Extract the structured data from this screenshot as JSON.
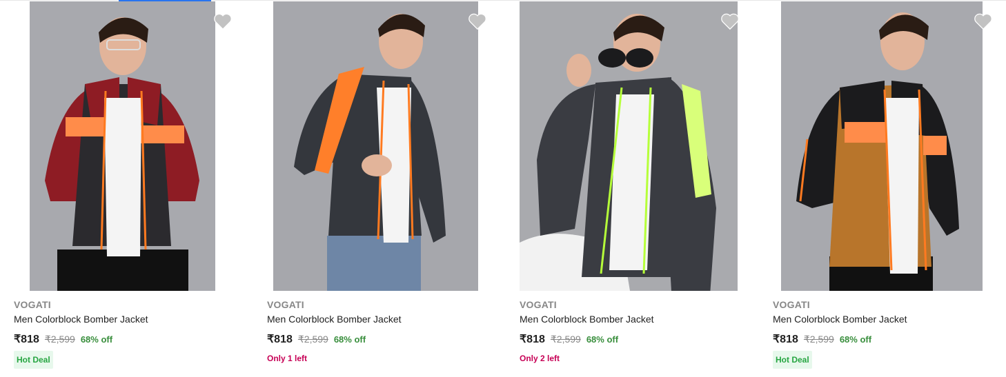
{
  "products": [
    {
      "brand": "VOGATI",
      "title": "Men Colorblock Bomber Jacket",
      "price": "₹818",
      "mrp": "₹2,599",
      "discount": "68% off",
      "badge": "Hot Deal",
      "stock": "",
      "image_icon": "product-photo",
      "colors": {
        "sleeve": "#8e1c24",
        "body": "#2b2a2e",
        "stripe": "#ff8c4a",
        "trim": "#ff7a20"
      }
    },
    {
      "brand": "VOGATI",
      "title": "Men Colorblock Bomber Jacket",
      "price": "₹818",
      "mrp": "₹2,599",
      "discount": "68% off",
      "badge": "",
      "stock": "Only 1 left",
      "image_icon": "product-photo",
      "colors": {
        "sleeve": "#34373d",
        "body": "#34373d",
        "stripe": "#ff7f2a",
        "trim": "#ff7a20"
      }
    },
    {
      "brand": "VOGATI",
      "title": "Men Colorblock Bomber Jacket",
      "price": "₹818",
      "mrp": "₹2,599",
      "discount": "68% off",
      "badge": "",
      "stock": "Only 2 left",
      "image_icon": "product-photo",
      "colors": {
        "sleeve": "#3a3c42",
        "body": "#3a3c42",
        "stripe": "#d9ff7a",
        "trim": "#b6ff3a"
      }
    },
    {
      "brand": "VOGATI",
      "title": "Men Colorblock Bomber Jacket",
      "price": "₹818",
      "mrp": "₹2,599",
      "discount": "68% off",
      "badge": "Hot Deal",
      "stock": "",
      "image_icon": "product-photo",
      "colors": {
        "sleeve": "#1b1b1d",
        "body": "#b8752b",
        "stripe": "#ff8c4a",
        "trim": "#ff7a20"
      }
    }
  ],
  "wishlist_icon": "heart-icon",
  "accent_color": "#2874f0"
}
